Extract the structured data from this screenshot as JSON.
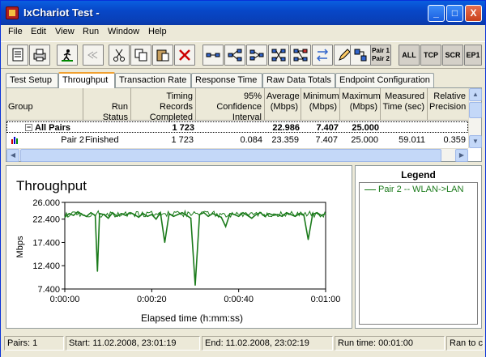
{
  "window": {
    "title": "IxChariot Test -",
    "controls": {
      "minimize": "_",
      "maximize": "□",
      "close": "X"
    }
  },
  "menu": [
    "File",
    "Edit",
    "View",
    "Run",
    "Window",
    "Help"
  ],
  "toolbar": {
    "text_buttons": [
      "ALL",
      "TCP",
      "SCR",
      "EP1"
    ],
    "pair_button": [
      "Pair 1",
      "Pair 2"
    ]
  },
  "tabs": [
    "Test Setup",
    "Throughput",
    "Transaction Rate",
    "Response Time",
    "Raw Data Totals",
    "Endpoint Configuration"
  ],
  "grid": {
    "headers": [
      [
        "Group"
      ],
      [
        "Run Status"
      ],
      [
        "Timing Records",
        "Completed"
      ],
      [
        "95% Confidence",
        "Interval"
      ],
      [
        "Average",
        "(Mbps)"
      ],
      [
        "Minimum",
        "(Mbps)"
      ],
      [
        "Maximum",
        "(Mbps)"
      ],
      [
        "Measured",
        "Time (sec)"
      ],
      [
        "Relative",
        "Precision"
      ]
    ],
    "rows": [
      {
        "group": "All Pairs",
        "expander": "−",
        "status": "",
        "records": "1 723",
        "confidence": "",
        "average": "22.986",
        "minimum": "7.407",
        "maximum": "25.000",
        "measured": "",
        "precision": ""
      },
      {
        "group": "Pair 2",
        "status": "Finished",
        "records": "1 723",
        "confidence": "0.084",
        "average": "23.359",
        "minimum": "7.407",
        "maximum": "25.000",
        "measured": "59.011",
        "precision": "0.359"
      }
    ]
  },
  "chart_data": {
    "type": "line",
    "title": "Throughput",
    "xlabel": "Elapsed time (h:mm:ss)",
    "ylabel": "Mbps",
    "ylim": [
      7.4,
      26.0
    ],
    "xlim": [
      0,
      60
    ],
    "yticks": [
      "26.000",
      "22.400",
      "17.400",
      "12.400",
      "7.400"
    ],
    "xticks": [
      "0:00:00",
      "0:00:20",
      "0:00:40",
      "0:01:00"
    ],
    "series": [
      {
        "name": "Pair 2 -- WLAN->LAN",
        "color": "#1a7a1a",
        "x": [
          0,
          1,
          2,
          3,
          4,
          5,
          6,
          7,
          7.5,
          8,
          9,
          10,
          11,
          12,
          13,
          14,
          15,
          16,
          17,
          18,
          19,
          20,
          21,
          22,
          23,
          24,
          25,
          26,
          27,
          28,
          29,
          30,
          31,
          32,
          33,
          34,
          35,
          36,
          37,
          38,
          39,
          40,
          41,
          42,
          43,
          44,
          45,
          46,
          47,
          48,
          49,
          50,
          51,
          52,
          53,
          54,
          55,
          56,
          57,
          58,
          59,
          60
        ],
        "y": [
          22.8,
          23.6,
          23.2,
          24.0,
          23.4,
          23.0,
          23.8,
          23.2,
          11.2,
          23.6,
          23.4,
          22.6,
          23.8,
          23.0,
          23.6,
          23.2,
          23.8,
          23.4,
          22.8,
          23.6,
          23.0,
          23.4,
          22.4,
          23.8,
          17.4,
          23.6,
          23.0,
          23.4,
          23.8,
          23.2,
          22.6,
          8.2,
          23.4,
          23.8,
          23.0,
          23.6,
          23.2,
          22.8,
          20.8,
          23.6,
          23.4,
          23.0,
          23.8,
          23.2,
          22.6,
          23.4,
          23.8,
          23.0,
          23.6,
          23.2,
          23.4,
          23.0,
          23.8,
          23.4,
          23.0,
          23.6,
          23.2,
          18.0,
          23.4,
          23.8,
          23.2,
          23.6
        ]
      }
    ]
  },
  "legend": {
    "title": "Legend",
    "entries": [
      "Pair 2 -- WLAN->LAN"
    ]
  },
  "status": {
    "pairs": "Pairs: 1",
    "start": "Start: 11.02.2008, 23:01:19",
    "end": "End: 11.02.2008, 23:02:19",
    "run_time": "Run time: 00:01:00",
    "ran_to": "Ran to c"
  }
}
